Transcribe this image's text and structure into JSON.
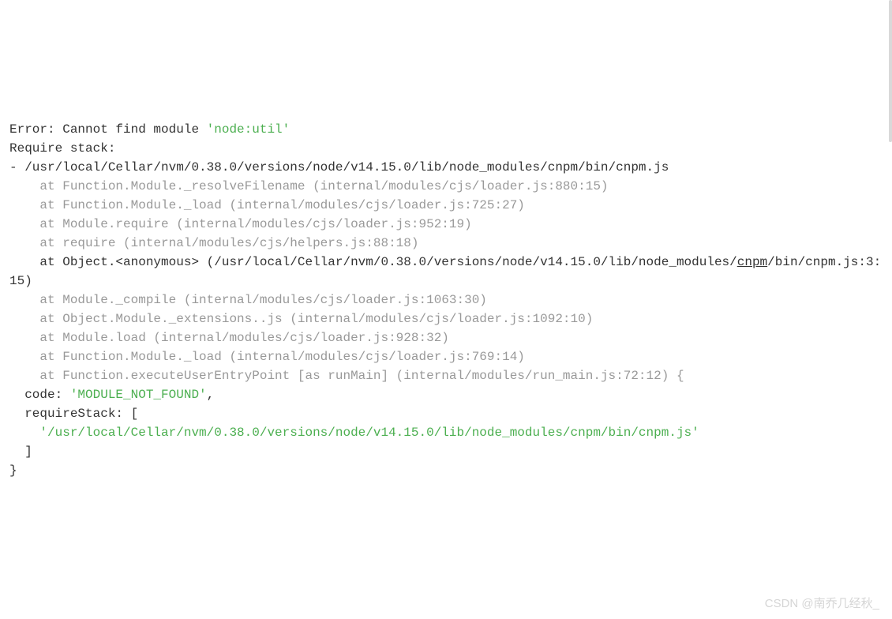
{
  "error_line1": "Error: Cannot find module ",
  "error_line1_module": "'node:util'",
  "error_line2": "Require stack:",
  "error_line3": "- /usr/local/Cellar/nvm/0.38.0/versions/node/v14.15.0/lib/node_modules/cnpm/bin/cnpm.js",
  "stack": [
    "    at Function.Module._resolveFilename (internal/modules/cjs/loader.js:880:15)",
    "    at Function.Module._load (internal/modules/cjs/loader.js:725:27)",
    "    at Module.require (internal/modules/cjs/loader.js:952:19)",
    "    at require (internal/modules/cjs/helpers.js:88:18)"
  ],
  "anon_prefix": "    at Object.<anonymous> (/usr/local/Cellar/nvm/0.38.0/versions/node/v14.15.0/lib/node_modules/",
  "anon_underline": "cnpm",
  "anon_suffix": "/bin/cnpm.js:3:15)",
  "stack2": [
    "    at Module._compile (internal/modules/cjs/loader.js:1063:30)",
    "    at Object.Module._extensions..js (internal/modules/cjs/loader.js:1092:10)",
    "    at Module.load (internal/modules/cjs/loader.js:928:32)",
    "    at Function.Module._load (internal/modules/cjs/loader.js:769:14)",
    "    at Function.executeUserEntryPoint [as runMain] (internal/modules/run_main.js:72:12) {"
  ],
  "code_label": "  code: ",
  "code_value": "'MODULE_NOT_FOUND'",
  "code_comma": ",",
  "requirestack_label": "  requireStack: [",
  "require_path": "    '/usr/local/Cellar/nvm/0.38.0/versions/node/v14.15.0/lib/node_modules/cnpm/bin/cnpm.js'",
  "close_bracket": "  ]",
  "close_brace": "}",
  "watermark": "CSDN @南乔几经秋_"
}
